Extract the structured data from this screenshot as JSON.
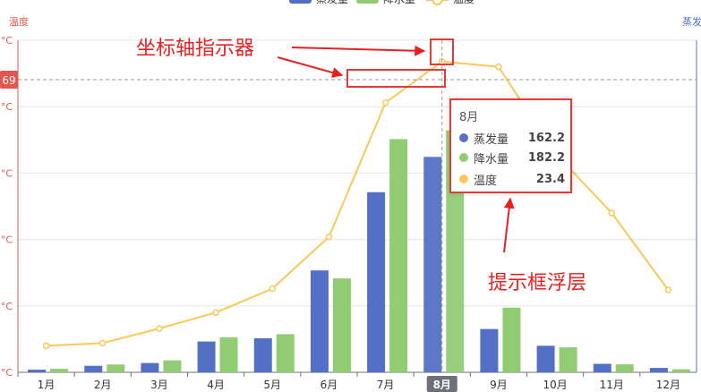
{
  "chart_data": {
    "type": "bar",
    "categories": [
      "1月",
      "2月",
      "3月",
      "4月",
      "5月",
      "6月",
      "7月",
      "8月",
      "9月",
      "10月",
      "11月",
      "12月"
    ],
    "series": [
      {
        "name": "蒸发量",
        "type": "bar",
        "axis": "left",
        "color": "#5470c6",
        "values": [
          2.0,
          4.9,
          7.0,
          23.2,
          25.6,
          76.7,
          135.6,
          162.2,
          32.6,
          20.0,
          6.4,
          3.3
        ]
      },
      {
        "name": "降水量",
        "type": "bar",
        "axis": "left",
        "color": "#91cc75",
        "values": [
          2.6,
          5.9,
          9.0,
          26.4,
          28.7,
          70.7,
          175.6,
          182.2,
          48.7,
          18.8,
          6.0,
          2.3
        ]
      },
      {
        "name": "温度",
        "type": "line",
        "axis": "right",
        "color": "#fac858",
        "values": [
          2.0,
          2.2,
          3.3,
          4.5,
          6.3,
          10.2,
          20.3,
          23.4,
          23.0,
          16.5,
          12.0,
          6.2
        ]
      }
    ],
    "yaxis_left": {
      "name": "温度",
      "unit": "°C",
      "ylim": [
        0,
        250
      ]
    },
    "yaxis_right": {
      "name": "蒸发",
      "ylim": [
        0,
        25
      ]
    },
    "axis_pointer": {
      "category": "8月",
      "value_label": "69"
    },
    "tooltip": {
      "title": "8月",
      "rows": [
        {
          "name": "蒸发量",
          "value": "162.2",
          "color": "#5470c6"
        },
        {
          "name": "降水量",
          "value": "182.2",
          "color": "#91cc75"
        },
        {
          "name": "温度",
          "value": "23.4",
          "color": "#fac858"
        }
      ]
    },
    "annotations": [
      {
        "text": "坐标轴指示器"
      },
      {
        "text": "提示框浮层"
      }
    ],
    "legend_position": "top-center",
    "grid": true
  }
}
